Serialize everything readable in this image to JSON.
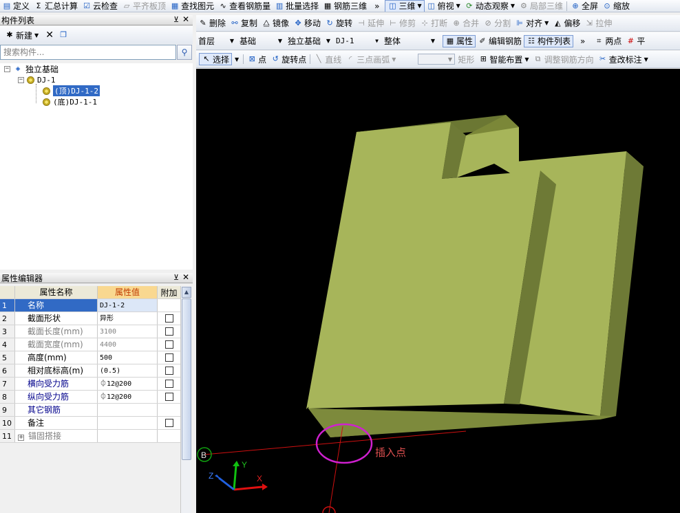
{
  "toolbar": {
    "items": [
      "定义",
      "汇总计算",
      "云检查",
      "平齐板顶",
      "查找图元",
      "查看钢筋量",
      "批量选择",
      "钢筋三维"
    ],
    "view_items": [
      "三维",
      "俯视",
      "动态观察",
      "局部三维",
      "全屏",
      "缩放"
    ],
    "more": "»"
  },
  "component_list": {
    "title": "构件列表",
    "new_label": "新建",
    "search_placeholder": "搜索构件...",
    "tree": {
      "root": "独立基础",
      "child": "DJ-1",
      "leaves": [
        "(顶)DJ-1-2",
        "(底)DJ-1-1"
      ]
    }
  },
  "property_editor": {
    "title": "属性编辑器",
    "headers": {
      "name": "属性名称",
      "value": "属性值",
      "add": "附加"
    },
    "rows": [
      {
        "num": "1",
        "name": "名称",
        "value": "DJ-1-2",
        "check": false,
        "style": "normal"
      },
      {
        "num": "2",
        "name": "截面形状",
        "value": "异形",
        "check": true,
        "style": "normal"
      },
      {
        "num": "3",
        "name": "截面长度(mm)",
        "value": "3100",
        "check": true,
        "style": "gray"
      },
      {
        "num": "4",
        "name": "截面宽度(mm)",
        "value": "4400",
        "check": true,
        "style": "gray"
      },
      {
        "num": "5",
        "name": "高度(mm)",
        "value": "500",
        "check": true,
        "style": "normal"
      },
      {
        "num": "6",
        "name": "相对底标高(m)",
        "value": "(0.5)",
        "check": true,
        "style": "normal"
      },
      {
        "num": "7",
        "name": "横向受力筋",
        "value": "⏀12@200",
        "check": true,
        "style": "blue"
      },
      {
        "num": "8",
        "name": "纵向受力筋",
        "value": "⏀12@200",
        "check": true,
        "style": "blue"
      },
      {
        "num": "9",
        "name": "其它钢筋",
        "value": "",
        "check": false,
        "style": "blue"
      },
      {
        "num": "10",
        "name": "备注",
        "value": "",
        "check": true,
        "style": "normal"
      },
      {
        "num": "11",
        "name": "锚固搭接",
        "value": "",
        "check": false,
        "style": "gray",
        "expand": "+"
      }
    ]
  },
  "edit_bar": {
    "items": [
      "删除",
      "复制",
      "镜像",
      "移动",
      "旋转",
      "延伸",
      "修剪",
      "打断",
      "合并",
      "分割",
      "对齐",
      "偏移",
      "拉伸"
    ],
    "more": "»"
  },
  "floor_bar": {
    "floor": "首层",
    "category": "基础",
    "type": "独立基础",
    "component": "DJ-1",
    "part": "整体",
    "buttons": [
      "属性",
      "编辑钢筋",
      "构件列表"
    ],
    "right": [
      "两点",
      "平"
    ],
    "more": "»"
  },
  "draw_bar": {
    "select": "选择",
    "items": [
      "点",
      "旋转点",
      "直线",
      "三点画弧",
      "",
      "矩形",
      "智能布置",
      "调整钢筋方向",
      "查改标注"
    ]
  },
  "viewport": {
    "insert_label": "插入点",
    "axis_x": "X",
    "axis_y": "Y",
    "axis_z": "Z",
    "grid_label": "B",
    "colors": {
      "face_top": "#a7b55a",
      "face_side": "#6e7a36",
      "face_front": "#8a9742",
      "insert": "#d020d0"
    }
  }
}
